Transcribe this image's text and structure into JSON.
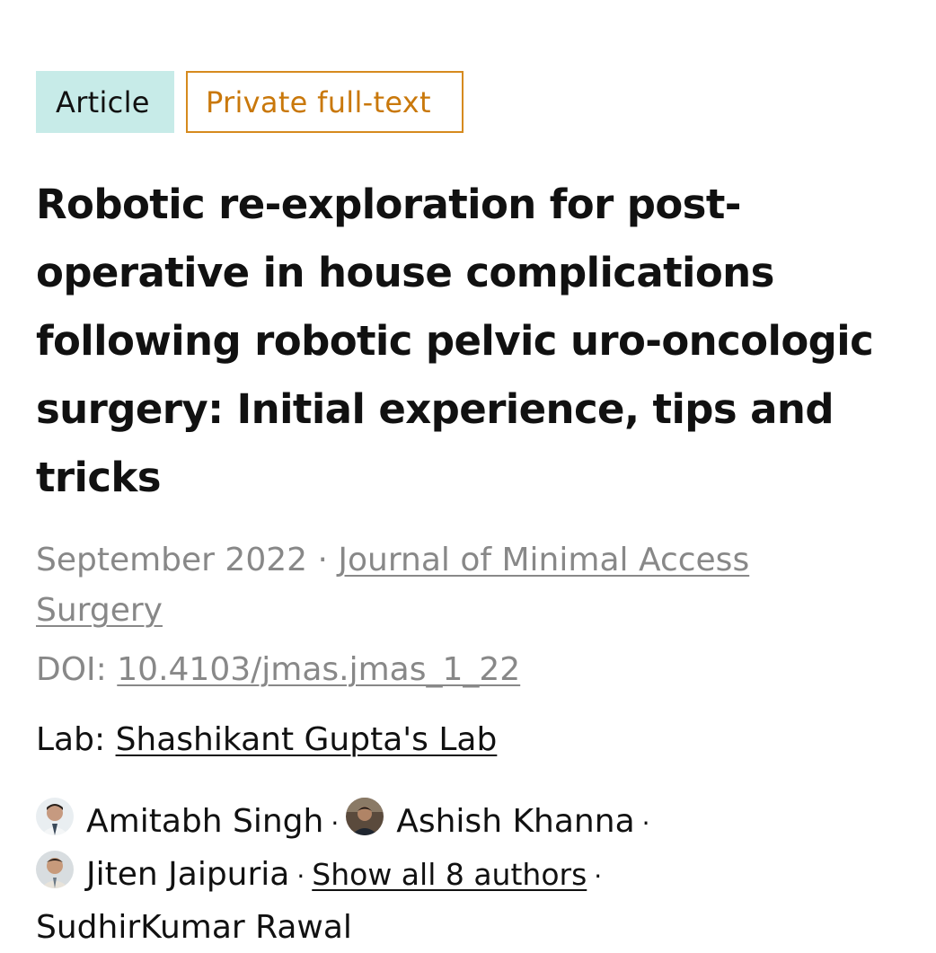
{
  "badges": {
    "type": "Article",
    "access": "Private full-text"
  },
  "title": "Robotic re-exploration for post-operative in house complications following robotic pelvic uro-oncologic surgery: Initial experience, tips and tricks",
  "meta": {
    "date": "September 2022",
    "separator": "·",
    "journal": "Journal of Minimal Access Surgery"
  },
  "doi": {
    "label": "DOI:",
    "value": "10.4103/jmas.jmas_1_22"
  },
  "lab": {
    "label": "Lab:",
    "name": "Shashikant Gupta's Lab"
  },
  "authors": {
    "list": [
      {
        "name": "Amitabh Singh"
      },
      {
        "name": "Ashish Khanna"
      },
      {
        "name": "Jiten Jaipuria"
      }
    ],
    "show_all": "Show all 8 authors",
    "last": "SudhirKumar Rawal",
    "separator": "·"
  },
  "colors": {
    "article_badge_bg": "#c7ebe8",
    "private_badge": "#d68a1e",
    "muted_text": "#888888"
  }
}
